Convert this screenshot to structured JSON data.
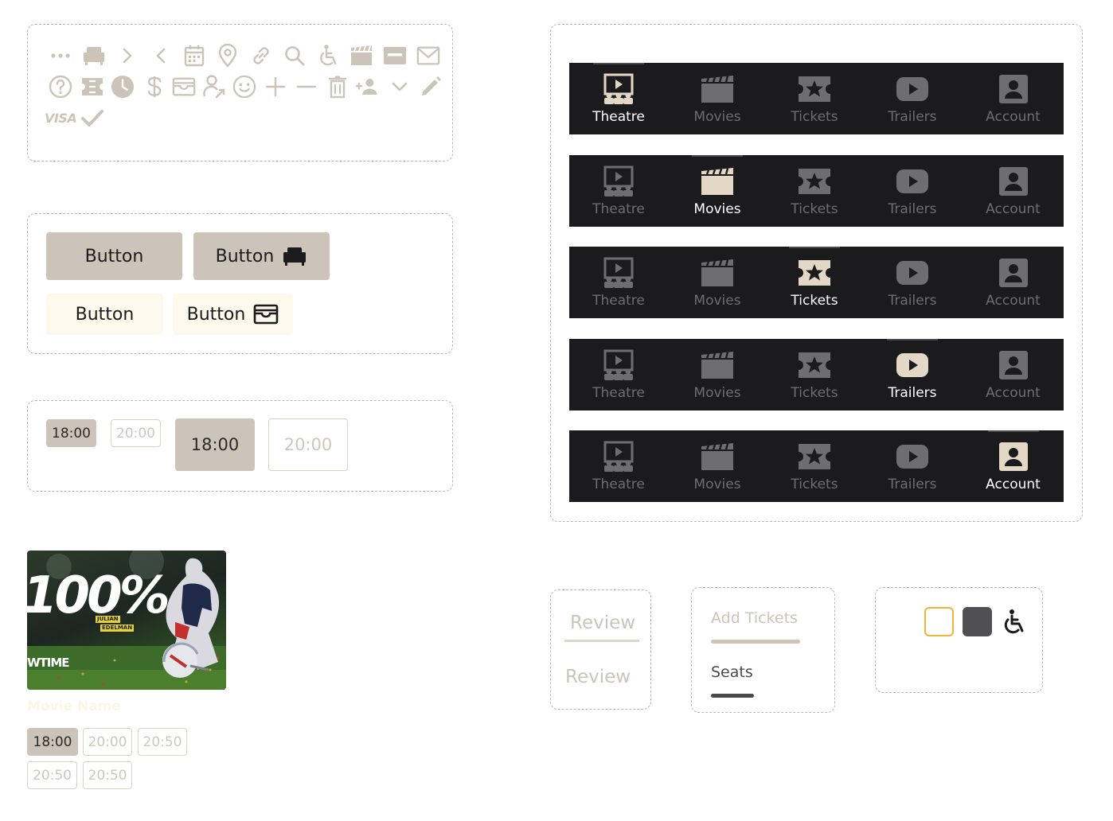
{
  "colors": {
    "primary": "#ccc4b8",
    "secondary": "#fdf9ec",
    "dark": "#1b1b1d",
    "icon_gray": "#ccc4b8",
    "nav_inactive": "#6e6e70",
    "nav_active_icon": "#e3d8c6",
    "selected_outline": "#f2b33d",
    "occupied_seat": "#505052"
  },
  "icon_library": {
    "row1": [
      "more-horizontal-icon",
      "armchair-icon",
      "chevron-right-icon",
      "chevron-left-icon",
      "calendar-icon",
      "map-pin-icon",
      "link-icon",
      "search-icon",
      "wheelchair-icon",
      "clapperboard-icon",
      "credit-card-icon",
      "mail-icon"
    ],
    "row2": [
      "help-circle-icon",
      "ticket-icon",
      "clock-icon",
      "dollar-icon",
      "wallet-icon",
      "user-share-icon",
      "smiley-icon",
      "plus-icon",
      "minus-icon",
      "trash-icon",
      "add-user-icon",
      "chevron-down-icon",
      "pencil-icon"
    ],
    "row3": [
      "visa-icon",
      "checkmark-icon"
    ],
    "visa_text": "VISA"
  },
  "buttons": {
    "primary_text": "Button",
    "primary_icon_text": "Button",
    "secondary_text": "Button",
    "secondary_icon_text": "Button"
  },
  "showtimes_small": {
    "selected": "18:00",
    "unselected": "20:00"
  },
  "showtimes_large": {
    "selected": "18:00",
    "unselected": "20:00"
  },
  "navigation": {
    "items": [
      {
        "id": "theatre",
        "label": "Theatre",
        "icon": "theatre-icon"
      },
      {
        "id": "movies",
        "label": "Movies",
        "icon": "clapperboard-icon"
      },
      {
        "id": "tickets",
        "label": "Tickets",
        "icon": "ticket-star-icon"
      },
      {
        "id": "trailers",
        "label": "Trailers",
        "icon": "play-icon"
      },
      {
        "id": "account",
        "label": "Account",
        "icon": "account-icon"
      }
    ],
    "variants_active_index": [
      0,
      1,
      2,
      3,
      4
    ]
  },
  "movie_card": {
    "poster_big_text": "100%",
    "poster_small_text_1": "JULIAN",
    "poster_small_text_2": "EDELMAN",
    "poster_brand": "WTIME",
    "title": "Movie Name",
    "times_row1": [
      "18:00",
      "20:00",
      "20:50"
    ],
    "times_row2": [
      "20:50",
      "20:50"
    ]
  },
  "review_tabs": {
    "active": "Review",
    "inactive": "Review"
  },
  "stepper_tabs": {
    "inactive": "Add Tickets",
    "active": "Seats"
  }
}
